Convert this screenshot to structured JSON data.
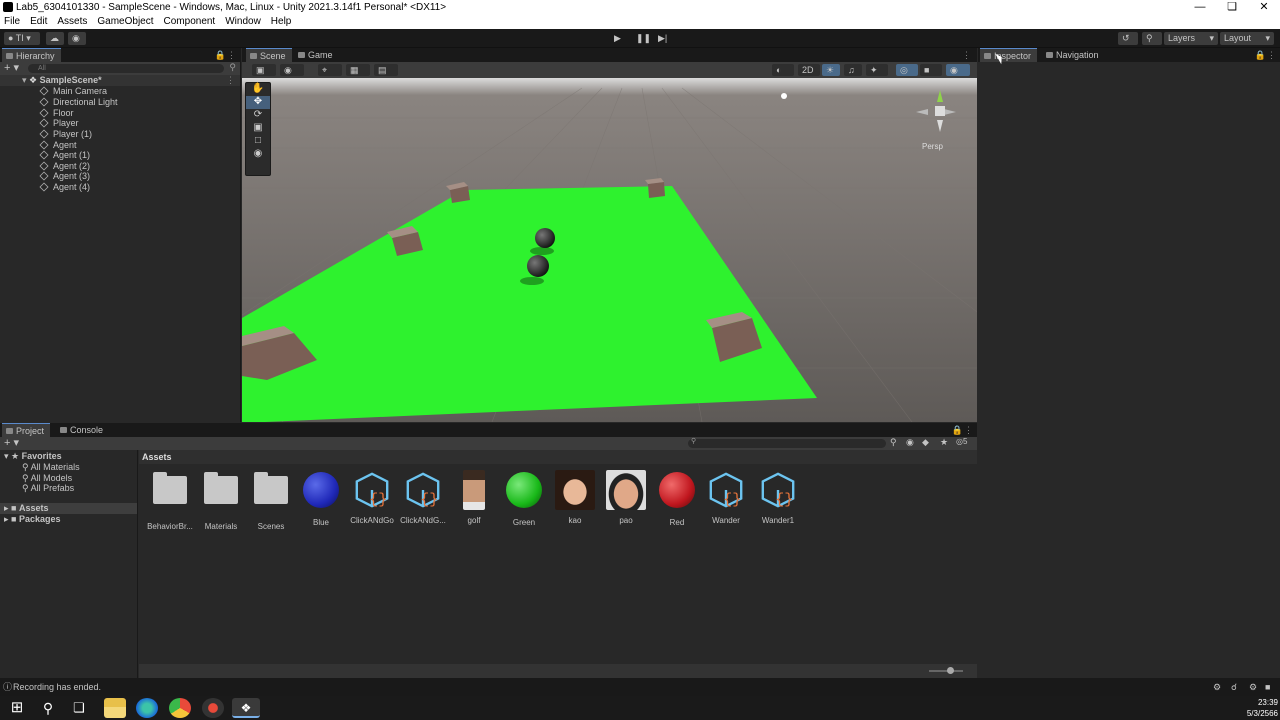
{
  "window": {
    "title": "Lab5_6304101330 - SampleScene - Windows, Mac, Linux - Unity 2021.3.14f1 Personal* <DX11>"
  },
  "menu": [
    "File",
    "Edit",
    "Assets",
    "GameObject",
    "Component",
    "Window",
    "Help"
  ],
  "toolbar": {
    "account": "TI",
    "layers": "Layers",
    "layout": "Layout"
  },
  "hierarchy": {
    "tab": "Hierarchy",
    "search": "All",
    "scene": "SampleScene*",
    "items": [
      "Main Camera",
      "Directional Light",
      "Floor",
      "Player",
      "Player (1)",
      "Agent",
      "Agent (1)",
      "Agent (2)",
      "Agent (3)",
      "Agent (4)"
    ]
  },
  "scene": {
    "tabs": [
      "Scene",
      "Game"
    ],
    "mode2d": "2D",
    "persp": "Persp"
  },
  "inspector": {
    "tabs": [
      "Inspector",
      "Navigation"
    ]
  },
  "project": {
    "tabs": [
      "Project",
      "Console"
    ],
    "favorites": "Favorites",
    "fav_items": [
      "All Materials",
      "All Models",
      "All Prefabs"
    ],
    "tree": [
      "Assets",
      "Packages"
    ],
    "breadcrumb": "Assets",
    "count": "5",
    "assets": [
      {
        "name": "BehaviorBr...",
        "kind": "folder"
      },
      {
        "name": "Materials",
        "kind": "folder"
      },
      {
        "name": "Scenes",
        "kind": "folder"
      },
      {
        "name": "Blue",
        "kind": "material",
        "color": "#1f28b8"
      },
      {
        "name": "ClickANdGo",
        "kind": "script"
      },
      {
        "name": "ClickANdG...",
        "kind": "script"
      },
      {
        "name": "golf",
        "kind": "image"
      },
      {
        "name": "Green",
        "kind": "material",
        "color": "#18b818"
      },
      {
        "name": "kao",
        "kind": "image"
      },
      {
        "name": "pao",
        "kind": "image"
      },
      {
        "name": "Red",
        "kind": "material",
        "color": "#c0161e"
      },
      {
        "name": "Wander",
        "kind": "script"
      },
      {
        "name": "Wander1",
        "kind": "script"
      }
    ]
  },
  "status": {
    "text": "Recording has ended."
  },
  "clock": {
    "time": "23:39",
    "date": "5/3/2566"
  },
  "colors": {
    "floor": "#2ef22e",
    "selection": "#2c5d87",
    "accent": "#5a8acc"
  }
}
